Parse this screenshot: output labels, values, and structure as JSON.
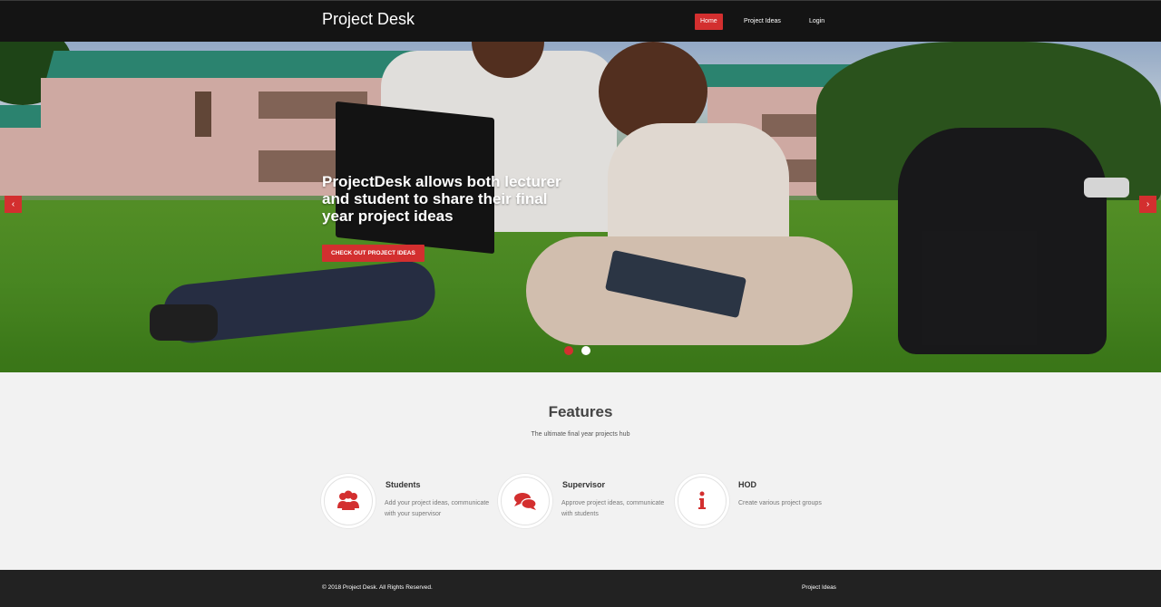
{
  "nav": {
    "brand": "Project Desk",
    "items": [
      {
        "label": "Home",
        "active": true
      },
      {
        "label": "Project Ideas",
        "active": false
      },
      {
        "label": "Login",
        "active": false
      }
    ]
  },
  "hero": {
    "title": "ProjectDesk allows both lecturer and student to share their final year project ideas",
    "cta": "CHECK OUT PROJECT IDEAS",
    "prev_icon": "chevron-left-icon",
    "next_icon": "chevron-right-icon",
    "slides_total": 2,
    "active_slide": 1
  },
  "features": {
    "title": "Features",
    "subtitle": "The ultimate final year projects hub",
    "items": [
      {
        "icon": "users-icon",
        "name": "Students",
        "description": "Add your project ideas, communicate with your supervisor"
      },
      {
        "icon": "comments-icon",
        "name": "Supervisor",
        "description": "Approve project ideas, communicate with students"
      },
      {
        "icon": "info-icon",
        "name": "HOD",
        "description": "Create various project groups"
      }
    ]
  },
  "footer": {
    "copyright": "© 2018 Project Desk. All Rights Reserved.",
    "link": "Project Ideas"
  },
  "colors": {
    "accent": "#d32f2f",
    "navbar": "#141414",
    "footer": "#222222",
    "body": "#f2f2f2"
  }
}
